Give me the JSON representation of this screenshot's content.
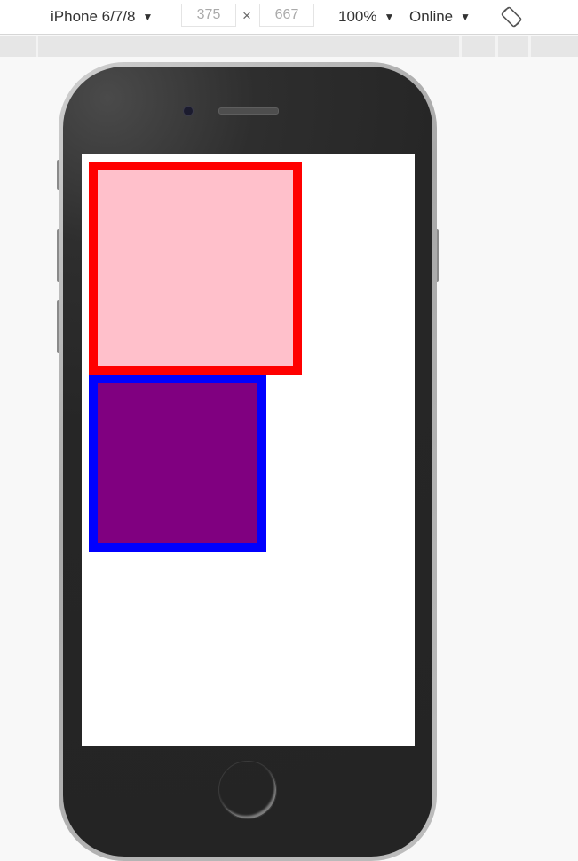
{
  "toolbar": {
    "device": "iPhone 6/7/8",
    "width_value": "375",
    "times_symbol": "×",
    "height_value": "667",
    "zoom": "100%",
    "network": "Online",
    "caret": "▼"
  },
  "icons": {
    "dropdown": "caret-down-icon",
    "rotate": "rotate-device-icon"
  },
  "colors": {
    "box1_fill": "pink",
    "box1_border": "red",
    "box2_fill": "purple",
    "box2_border": "blue",
    "screen_bg": "#ffffff"
  }
}
